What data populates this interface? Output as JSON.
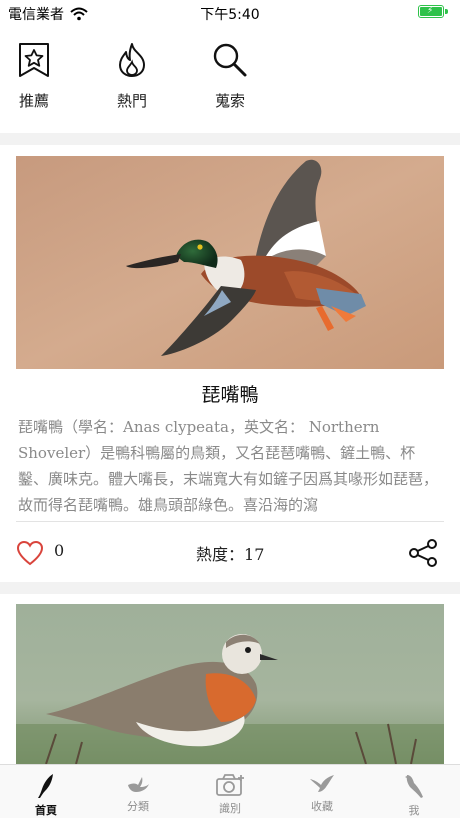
{
  "status_bar": {
    "carrier": "電信業者",
    "time": "下午5:40"
  },
  "top_menu": {
    "items": [
      {
        "label": "推薦",
        "icon": "star-bookmark-icon"
      },
      {
        "label": "熱門",
        "icon": "flame-icon"
      },
      {
        "label": "蒐索",
        "icon": "search-icon"
      }
    ]
  },
  "cards": [
    {
      "title": "琵嘴鴨",
      "description": "琵嘴鴨（學名：Anas clypeata，英文名： Northern Shoveler）是鴨科鴨屬的鳥類，又名琵琶嘴鴨、鏟土鴨、杯鑿、廣味克。體大嘴長，末端寬大有如鏟子因爲其喙形如琵琶，故而得名琵嘴鴨。雄鳥頭部綠色。喜沿海的瀉",
      "likes": "0",
      "heat_label": "熱度：",
      "heat_value": "17",
      "image": "northern-shoveler-duck-photo"
    },
    {
      "image": "plover-bird-photo"
    }
  ],
  "tab_bar": {
    "tabs": [
      {
        "label": "首頁",
        "icon": "feather-icon",
        "active": true
      },
      {
        "label": "分類",
        "icon": "bird-icon",
        "active": false
      },
      {
        "label": "識別",
        "icon": "camera-icon",
        "active": false
      },
      {
        "label": "收藏",
        "icon": "flying-bird-icon",
        "active": false
      },
      {
        "label": "我",
        "icon": "perched-bird-icon",
        "active": false
      }
    ]
  },
  "colors": {
    "like_heart": "#d9443c",
    "battery": "#2ec24a",
    "active_tab": "#111111",
    "inactive_tab": "#8e8e8e"
  }
}
